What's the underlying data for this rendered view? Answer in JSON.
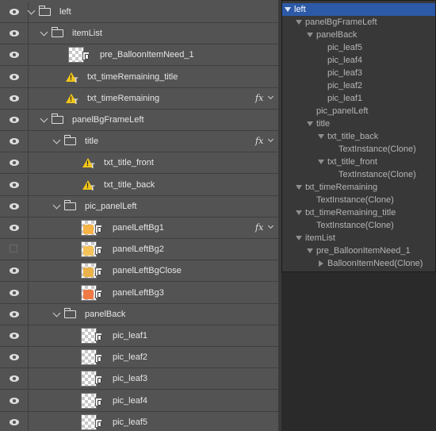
{
  "layers": [
    {
      "label": "left",
      "icon": "folder",
      "depth": 0,
      "expanded": true,
      "visible": true,
      "fx": false
    },
    {
      "label": "itemList",
      "icon": "folder",
      "depth": 1,
      "expanded": true,
      "visible": true,
      "fx": false
    },
    {
      "label": "pre_BalloonItemNeed_1",
      "icon": "thumbnail",
      "depth": 2,
      "visible": true,
      "fx": false,
      "thumb_color": ""
    },
    {
      "label": "txt_timeRemaining_title",
      "icon": "warning-text",
      "depth": 1,
      "visible": true,
      "fx": false
    },
    {
      "label": "txt_timeRemaining",
      "icon": "warning-text",
      "depth": 1,
      "visible": true,
      "fx": true
    },
    {
      "label": "panelBgFrameLeft",
      "icon": "folder",
      "depth": 1,
      "expanded": true,
      "visible": true,
      "fx": false
    },
    {
      "label": "title",
      "icon": "folder",
      "depth": 2,
      "expanded": true,
      "visible": true,
      "fx": true
    },
    {
      "label": "txt_title_front",
      "icon": "warning-text",
      "depth": 3,
      "visible": true,
      "fx": false
    },
    {
      "label": "txt_title_back",
      "icon": "warning-text",
      "depth": 3,
      "visible": true,
      "fx": false
    },
    {
      "label": "pic_panelLeft",
      "icon": "folder",
      "depth": 2,
      "expanded": true,
      "visible": true,
      "fx": false
    },
    {
      "label": "panelLeftBg1",
      "icon": "thumbnail",
      "depth": 3,
      "visible": true,
      "fx": true,
      "thumb_color": "#f6b347"
    },
    {
      "label": "panelLeftBg2",
      "icon": "thumbnail",
      "depth": 3,
      "visible": false,
      "fx": false,
      "thumb_color": "#f4c25a"
    },
    {
      "label": "panelLeftBgClose",
      "icon": "thumbnail",
      "depth": 3,
      "visible": true,
      "fx": false,
      "thumb_color": "#e9b24a"
    },
    {
      "label": "panelLeftBg3",
      "icon": "thumbnail",
      "depth": 3,
      "visible": true,
      "fx": false,
      "thumb_color": "#f07a45"
    },
    {
      "label": "panelBack",
      "icon": "folder",
      "depth": 2,
      "expanded": true,
      "visible": true,
      "fx": false
    },
    {
      "label": "pic_leaf1",
      "icon": "thumbnail",
      "depth": 3,
      "visible": true,
      "fx": false,
      "thumb_color": ""
    },
    {
      "label": "pic_leaf2",
      "icon": "thumbnail",
      "depth": 3,
      "visible": true,
      "fx": false,
      "thumb_color": ""
    },
    {
      "label": "pic_leaf3",
      "icon": "thumbnail",
      "depth": 3,
      "visible": true,
      "fx": false,
      "thumb_color": ""
    },
    {
      "label": "pic_leaf4",
      "icon": "thumbnail",
      "depth": 3,
      "visible": true,
      "fx": false,
      "thumb_color": ""
    },
    {
      "label": "pic_leaf5",
      "icon": "thumbnail",
      "depth": 3,
      "visible": true,
      "fx": false,
      "thumb_color": ""
    }
  ],
  "effects_label": "fx",
  "hierarchy": [
    {
      "label": "left",
      "depth": 0,
      "arrow": "down",
      "selected": true
    },
    {
      "label": "panelBgFrameLeft",
      "depth": 1,
      "arrow": "down",
      "selected": false
    },
    {
      "label": "panelBack",
      "depth": 2,
      "arrow": "down",
      "selected": false
    },
    {
      "label": "pic_leaf5",
      "depth": 3,
      "arrow": "none",
      "selected": false
    },
    {
      "label": "pic_leaf4",
      "depth": 3,
      "arrow": "none",
      "selected": false
    },
    {
      "label": "pic_leaf3",
      "depth": 3,
      "arrow": "none",
      "selected": false
    },
    {
      "label": "pic_leaf2",
      "depth": 3,
      "arrow": "none",
      "selected": false
    },
    {
      "label": "pic_leaf1",
      "depth": 3,
      "arrow": "none",
      "selected": false
    },
    {
      "label": "pic_panelLeft",
      "depth": 2,
      "arrow": "none",
      "selected": false
    },
    {
      "label": "title",
      "depth": 2,
      "arrow": "down",
      "selected": false
    },
    {
      "label": "txt_title_back",
      "depth": 3,
      "arrow": "down",
      "selected": false
    },
    {
      "label": "TextInstance(Clone)",
      "depth": 4,
      "arrow": "none",
      "selected": false
    },
    {
      "label": "txt_title_front",
      "depth": 3,
      "arrow": "down",
      "selected": false
    },
    {
      "label": "TextInstance(Clone)",
      "depth": 4,
      "arrow": "none",
      "selected": false
    },
    {
      "label": "txt_timeRemaining",
      "depth": 1,
      "arrow": "down",
      "selected": false
    },
    {
      "label": "TextInstance(Clone)",
      "depth": 2,
      "arrow": "none",
      "selected": false
    },
    {
      "label": "txt_timeRemaining_title",
      "depth": 1,
      "arrow": "down",
      "selected": false
    },
    {
      "label": "TextInstance(Clone)",
      "depth": 2,
      "arrow": "none",
      "selected": false
    },
    {
      "label": "itemList",
      "depth": 1,
      "arrow": "down",
      "selected": false
    },
    {
      "label": "pre_BalloonItemNeed_1",
      "depth": 2,
      "arrow": "down",
      "selected": false
    },
    {
      "label": "BalloonItemNeed(Clone)",
      "depth": 3,
      "arrow": "right",
      "selected": false
    }
  ],
  "colors": {
    "selection": "#2d5aa7",
    "warning": "#f0c419"
  }
}
